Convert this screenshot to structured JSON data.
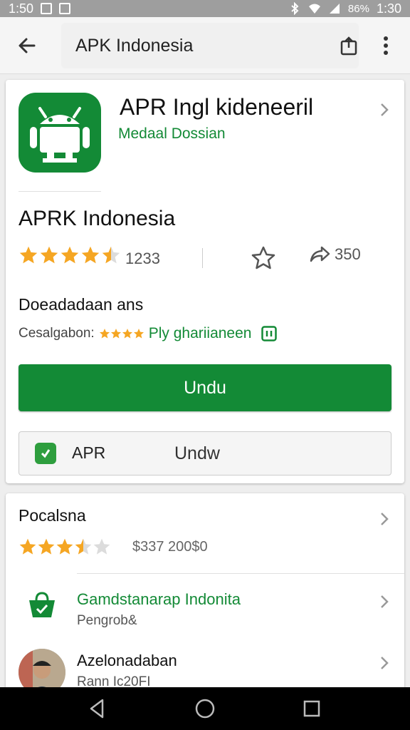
{
  "status_bar": {
    "time_left": "1:50",
    "battery": "86%",
    "time_right": "1:30"
  },
  "app_bar": {
    "search_text": "APK Indonesia"
  },
  "app_header": {
    "title": "APR Ingl kideneeril",
    "developer": "Medaal Dossian"
  },
  "app": {
    "name": "APRK Indonesia",
    "rating": 4.5,
    "rating_count": "1233",
    "share_count": "350"
  },
  "details": {
    "title": "Doeadadaan ans",
    "sub_label": "Cesalgabon:",
    "sub_link": "Ply ghariianeen"
  },
  "install_button": {
    "label": "Undu"
  },
  "secondary_button": {
    "apk_label": "APR",
    "action_label": "Undw"
  },
  "related": {
    "title": "Pocalsna",
    "rating": 3.5,
    "count_text": "$337 200$0",
    "items": [
      {
        "title": "Gamdstanarap Indonita",
        "subtitle": "Pengrob&"
      },
      {
        "title": "Azelonadaban",
        "subtitle": "Rann Ic20FI"
      }
    ]
  },
  "colors": {
    "accent": "#138a36",
    "star": "#f5a623"
  },
  "icons": {
    "back": "back-arrow-icon",
    "share": "share-icon",
    "more": "more-vert-icon",
    "wishlist": "star-outline-icon",
    "forward": "share-forward-icon",
    "chevron": "chevron-right-icon",
    "bag": "shopping-bag-icon"
  }
}
